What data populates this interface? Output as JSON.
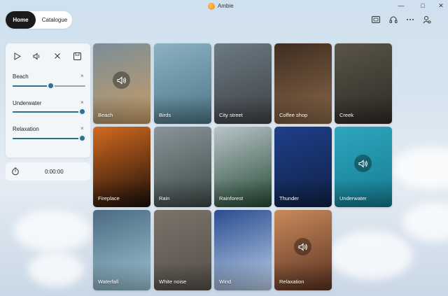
{
  "app": {
    "title": "Ambie"
  },
  "window_controls": {
    "minimize": "—",
    "maximize": "□",
    "close": "✕"
  },
  "nav": {
    "tabs": [
      {
        "label": "Home",
        "active": true
      },
      {
        "label": "Catalogue",
        "active": false
      }
    ]
  },
  "toolbar_icons": [
    "screen-icon",
    "headset-icon",
    "more-icon",
    "account-settings-icon"
  ],
  "player": {
    "controls": [
      "play-icon",
      "volume-icon",
      "close-icon",
      "save-icon"
    ],
    "mixes": [
      {
        "label": "Beach",
        "remove": "×",
        "volume": 0.5
      },
      {
        "label": "Underwater",
        "remove": "×",
        "volume": 0.92
      },
      {
        "label": "Relaxation",
        "remove": "×",
        "volume": 0.92
      }
    ],
    "timer": {
      "icon": "timer-icon",
      "value": "0:00:00"
    }
  },
  "sounds": [
    {
      "label": "Beach",
      "playing": true,
      "colors": [
        "#7a8e98",
        "#c79c66"
      ]
    },
    {
      "label": "Birds",
      "playing": false,
      "colors": [
        "#8cb1c3",
        "#4c7787"
      ]
    },
    {
      "label": "City street",
      "playing": false,
      "colors": [
        "#6b7a83",
        "#3f4145"
      ]
    },
    {
      "label": "Coffee shop",
      "playing": false,
      "colors": [
        "#3e2d21",
        "#8a6849"
      ]
    },
    {
      "label": "Creek",
      "playing": false,
      "colors": [
        "#5a5547",
        "#2e2a26"
      ]
    },
    {
      "label": "Fireplace",
      "playing": false,
      "colors": [
        "#d46a1f",
        "#1a0f0a"
      ]
    },
    {
      "label": "Rain",
      "playing": false,
      "colors": [
        "#8a959a",
        "#3c4946"
      ]
    },
    {
      "label": "Rainforest",
      "playing": false,
      "colors": [
        "#b9c4c8",
        "#274a36"
      ]
    },
    {
      "label": "Thunder",
      "playing": false,
      "colors": [
        "#1f3f8a",
        "#0f2146"
      ]
    },
    {
      "label": "Underwater",
      "playing": true,
      "colors": [
        "#2ea6be",
        "#157c90"
      ]
    },
    {
      "label": "Waterfall",
      "playing": false,
      "colors": [
        "#4b6b80",
        "#9ec4d5"
      ]
    },
    {
      "label": "White noise",
      "playing": false,
      "colors": [
        "#7b736a",
        "#55504a"
      ]
    },
    {
      "label": "Wind",
      "playing": false,
      "colors": [
        "#2a4d90",
        "#bcd0e8"
      ]
    },
    {
      "label": "Relaxation",
      "playing": true,
      "colors": [
        "#c98a5c",
        "#5a3322"
      ]
    }
  ],
  "colors": {
    "accent": "#2f6f8f",
    "nav_active": "#1b1b1b"
  }
}
